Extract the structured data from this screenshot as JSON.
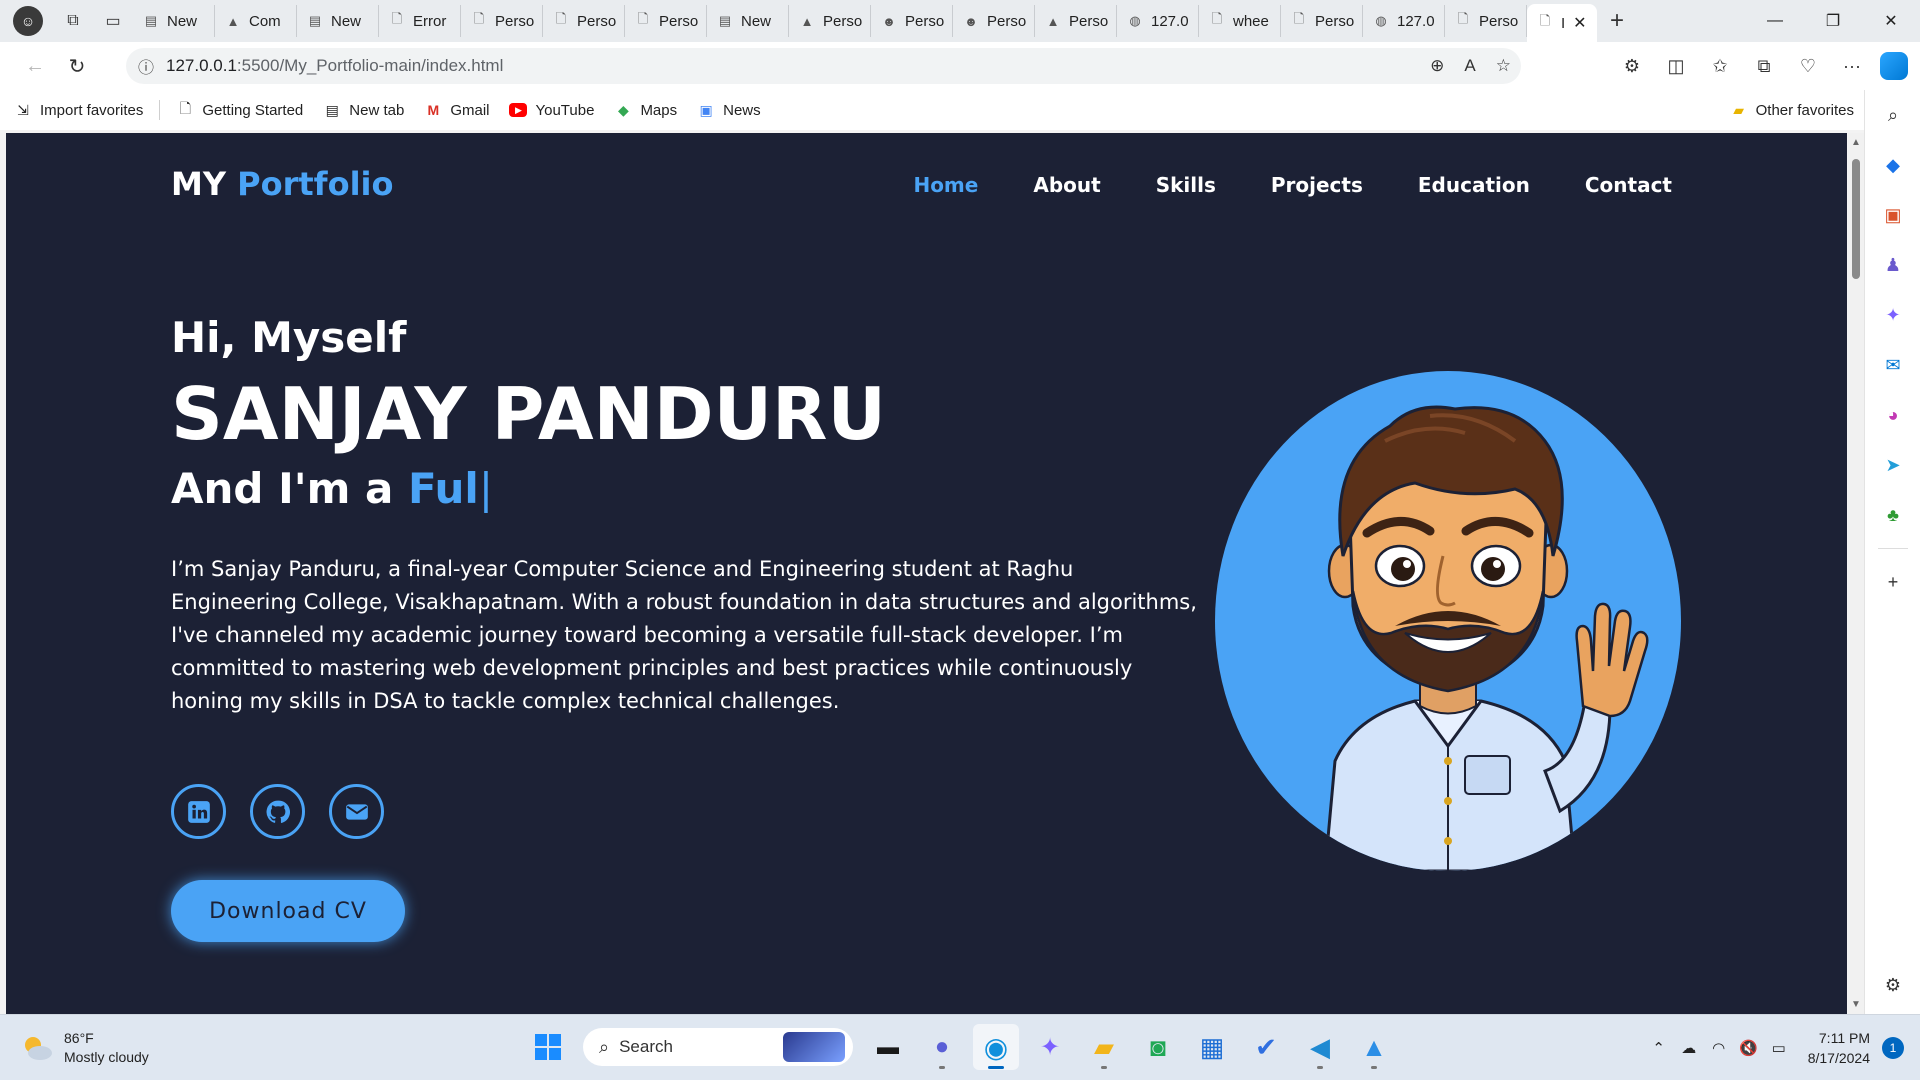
{
  "browser": {
    "tabs": [
      {
        "label": "New",
        "icon": "page-icon"
      },
      {
        "label": "Com",
        "icon": "drive-icon"
      },
      {
        "label": "New",
        "icon": "page-icon"
      },
      {
        "label": "Error",
        "icon": "doc-icon"
      },
      {
        "label": "Perso",
        "icon": "doc-icon"
      },
      {
        "label": "Perso",
        "icon": "doc-icon"
      },
      {
        "label": "Perso",
        "icon": "doc-icon"
      },
      {
        "label": "New",
        "icon": "page-icon"
      },
      {
        "label": "Perso",
        "icon": "drive-icon"
      },
      {
        "label": "Perso",
        "icon": "avatar-icon"
      },
      {
        "label": "Perso",
        "icon": "avatar-icon"
      },
      {
        "label": "Perso",
        "icon": "drive-icon"
      },
      {
        "label": "127.0",
        "icon": "globe-icon"
      },
      {
        "label": "whee",
        "icon": "doc-icon"
      },
      {
        "label": "Perso",
        "icon": "doc-icon"
      },
      {
        "label": "127.0",
        "icon": "globe-icon"
      },
      {
        "label": "Perso",
        "icon": "doc-icon"
      }
    ],
    "active_tab": {
      "label": "I"
    },
    "url_host": "127.0.0.1",
    "url_path": ":5500/My_Portfolio-main/index.html"
  },
  "favorites": {
    "items": [
      {
        "label": "Import favorites",
        "icon": "import-icon"
      },
      {
        "label": "Getting Started",
        "icon": "page-icon"
      },
      {
        "label": "New tab",
        "icon": "newtab-icon"
      },
      {
        "label": "Gmail",
        "icon": "gmail-icon"
      },
      {
        "label": "YouTube",
        "icon": "youtube-icon"
      },
      {
        "label": "Maps",
        "icon": "maps-icon"
      },
      {
        "label": "News",
        "icon": "news-icon"
      }
    ],
    "other": "Other favorites"
  },
  "site": {
    "logo_main": "MY ",
    "logo_accent": "Portfolio",
    "nav": [
      {
        "label": "Home",
        "active": true
      },
      {
        "label": "About"
      },
      {
        "label": "Skills"
      },
      {
        "label": "Projects"
      },
      {
        "label": "Education"
      },
      {
        "label": "Contact"
      }
    ],
    "greeting": "Hi, Myself",
    "name": "SANJAY PANDURU",
    "role_prefix": "And I'm a ",
    "role_typed": "Ful",
    "caret": "|",
    "bio": "I’m Sanjay Panduru, a final-year Computer Science and Engineering student at Raghu Engineering College, Visakhapatnam. With a robust foundation in data structures and algorithms, I've channeled my academic journey toward becoming a versatile full-stack developer. I’m committed to mastering web development principles and best practices while continuously honing my skills in DSA to tackle complex technical challenges.",
    "socials": [
      "linkedin-icon",
      "github-icon",
      "email-icon"
    ],
    "cta": "Download CV",
    "colors": {
      "background": "#1c2135",
      "accent": "#4aa3f5",
      "text": "#ffffff"
    }
  },
  "taskbar": {
    "weather_temp": "86°F",
    "weather_desc": "Mostly cloudy",
    "search_placeholder": "Search",
    "time": "7:11 PM",
    "date": "8/17/2024",
    "notifications": "1"
  }
}
